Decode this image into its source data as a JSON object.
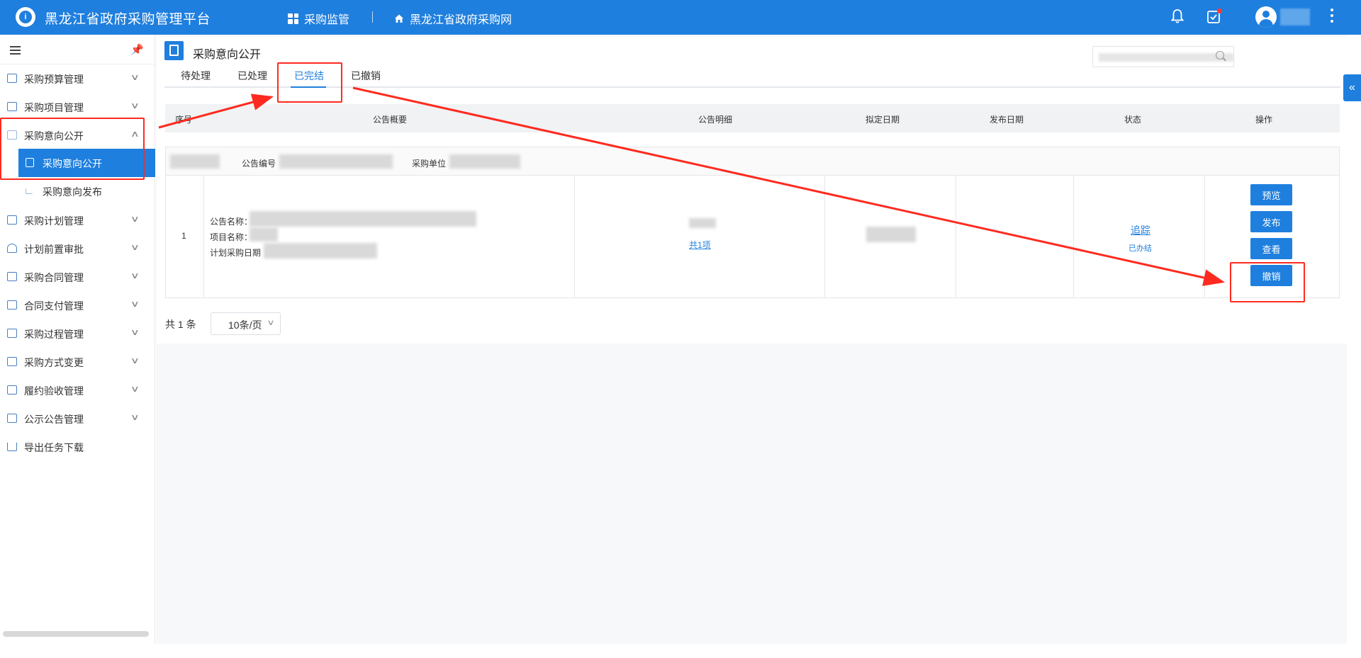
{
  "header": {
    "logo_text": "i",
    "app_title": "黑龙江省政府采购管理平台",
    "nav_supervision": "采购监管",
    "nav_portal": "黑龙江省政府采购网"
  },
  "sidebar": {
    "items": [
      {
        "label": "采购预算管理"
      },
      {
        "label": "采购项目管理"
      },
      {
        "label": "采购意向公开"
      },
      {
        "label": "采购计划管理"
      },
      {
        "label": "计划前置审批"
      },
      {
        "label": "采购合同管理"
      },
      {
        "label": "合同支付管理"
      },
      {
        "label": "采购过程管理"
      },
      {
        "label": "采购方式变更"
      },
      {
        "label": "履约验收管理"
      },
      {
        "label": "公示公告管理"
      },
      {
        "label": "导出任务下载"
      }
    ],
    "sub_items": [
      {
        "label": "采购意向公开"
      },
      {
        "label": "采购意向发布"
      }
    ]
  },
  "page": {
    "title": "采购意向公开",
    "tabs": [
      {
        "label": "待处理"
      },
      {
        "label": "已处理"
      },
      {
        "label": "已完结"
      },
      {
        "label": "已撤销"
      }
    ],
    "active_tab": "已完结"
  },
  "table": {
    "headers": [
      "序号",
      "公告概要",
      "公告明细",
      "拟定日期",
      "发布日期",
      "状态",
      "操作"
    ],
    "group_row": {
      "notice_no_label": "公告编号",
      "purchase_unit_label": "采购单位"
    },
    "rows": [
      {
        "index": "1",
        "notice_name_label": "公告名称：",
        "project_name_label": "项目名称：",
        "plan_date_label": "计划采购日期",
        "detail_link": "共1项",
        "status_link": "追踪",
        "status_text": "已办结",
        "actions": [
          "预览",
          "发布",
          "查看",
          "撤销"
        ]
      }
    ]
  },
  "pagination": {
    "total": "共 1 条",
    "page_size": "10条/页"
  },
  "colors": {
    "primary": "#1f7fde",
    "annotation": "#ff2a1f"
  }
}
